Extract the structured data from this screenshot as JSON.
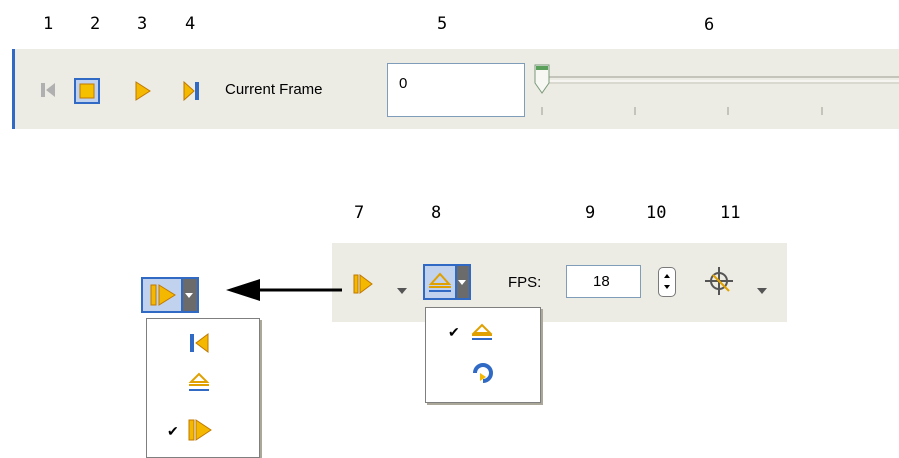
{
  "callout_numbers": [
    "1",
    "2",
    "3",
    "4",
    "5",
    "6",
    "7",
    "8",
    "9",
    "10",
    "11"
  ],
  "animation_toolbar": {
    "current_frame_label": "Current Frame",
    "current_frame_value": "0"
  },
  "playback_toolbar": {
    "fps_label": "FPS:",
    "fps_value": "18"
  },
  "play_mode_menu": {
    "items": [
      {
        "icon": "play-backward-icon",
        "checked": false
      },
      {
        "icon": "play-reverse-icon",
        "checked": false
      },
      {
        "icon": "play-forward-icon",
        "checked": true
      }
    ]
  },
  "loop_mode_menu": {
    "items": [
      {
        "icon": "play-once-icon",
        "checked": true
      },
      {
        "icon": "loop-icon",
        "checked": false
      }
    ]
  },
  "colors": {
    "toolbar_bg": "#ecebe4",
    "accent_blue": "#316ac5",
    "icon_yellow": "#f5b800",
    "slider_green": "#5aa05a"
  }
}
